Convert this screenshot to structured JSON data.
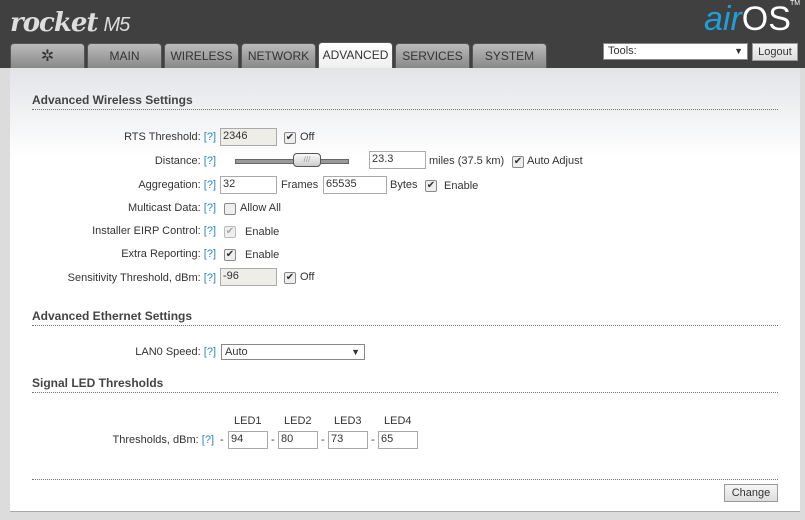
{
  "header": {
    "product": "rocket",
    "model": "M5",
    "brand_air": "air",
    "brand_os": "OS",
    "tm": "TM"
  },
  "tabs": [
    {
      "label": ""
    },
    {
      "label": "MAIN"
    },
    {
      "label": "WIRELESS"
    },
    {
      "label": "NETWORK"
    },
    {
      "label": "ADVANCED"
    },
    {
      "label": "SERVICES"
    },
    {
      "label": "SYSTEM"
    }
  ],
  "tools": {
    "value": "Tools:",
    "logout": "Logout"
  },
  "help": "[?]",
  "wireless": {
    "title": "Advanced Wireless Settings",
    "rts": {
      "label": "RTS Threshold:",
      "value": "2346",
      "off": "Off"
    },
    "distance": {
      "label": "Distance:",
      "value": "23.3",
      "unit": "miles (37.5 km)",
      "auto": "Auto Adjust",
      "slider_fraction": 0.55
    },
    "aggregation": {
      "label": "Aggregation:",
      "frames": "32",
      "frames_label": "Frames",
      "bytes": "65535",
      "bytes_label": "Bytes",
      "enable": "Enable"
    },
    "multicast": {
      "label": "Multicast Data:",
      "allow": "Allow All"
    },
    "eirp": {
      "label": "Installer EIRP Control:",
      "enable": "Enable"
    },
    "extra": {
      "label": "Extra Reporting:",
      "enable": "Enable"
    },
    "sensitivity": {
      "label": "Sensitivity Threshold, dBm:",
      "value": "-96",
      "off": "Off"
    }
  },
  "ethernet": {
    "title": "Advanced Ethernet Settings",
    "lan0": {
      "label": "LAN0 Speed:",
      "value": "Auto"
    }
  },
  "led": {
    "title": "Signal LED Thresholds",
    "label": "Thresholds, dBm:",
    "dash": "-",
    "items": [
      {
        "name": "LED1",
        "value": "94"
      },
      {
        "name": "LED2",
        "value": "80"
      },
      {
        "name": "LED3",
        "value": "73"
      },
      {
        "name": "LED4",
        "value": "65"
      }
    ]
  },
  "change": "Change"
}
